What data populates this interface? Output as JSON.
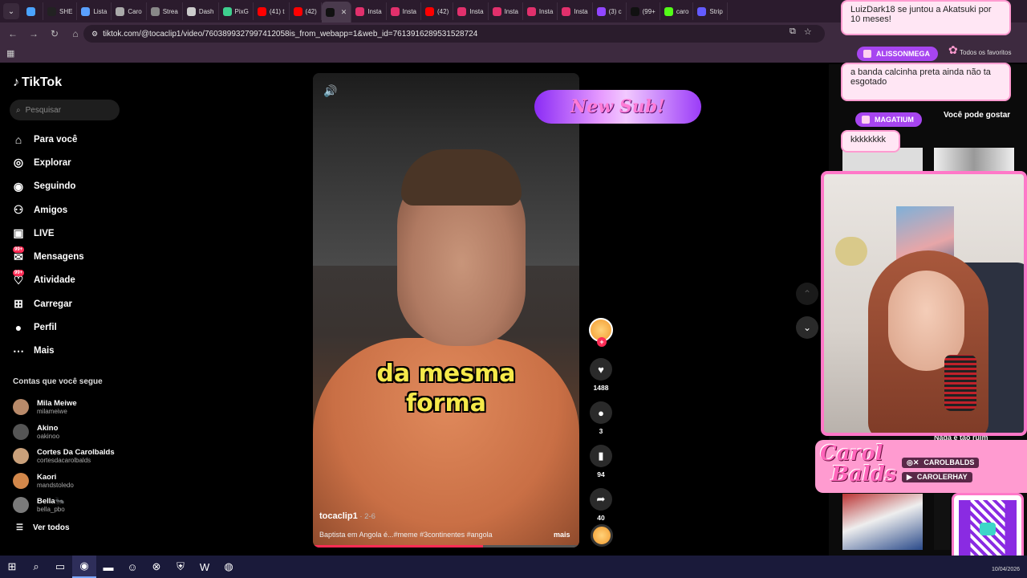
{
  "browser": {
    "tabs": [
      {
        "label": "",
        "color": "#4aa3ff"
      },
      {
        "label": "SHE",
        "color": "#222222"
      },
      {
        "label": "Lista",
        "color": "#5aa0ff"
      },
      {
        "label": "Caro",
        "color": "#aaaaaa"
      },
      {
        "label": "Strea",
        "color": "#888888"
      },
      {
        "label": "Dash",
        "color": "#cccccc"
      },
      {
        "label": "PixG",
        "color": "#3ecf8e"
      },
      {
        "label": "(41) t",
        "color": "#ff0000"
      },
      {
        "label": "(42)",
        "color": "#ff0000"
      },
      {
        "label": "",
        "color": "#111111",
        "active": true
      },
      {
        "label": "Insta",
        "color": "#e1306c"
      },
      {
        "label": "Insta",
        "color": "#e1306c"
      },
      {
        "label": "(42)",
        "color": "#ff0000"
      },
      {
        "label": "Insta",
        "color": "#e1306c"
      },
      {
        "label": "Insta",
        "color": "#e1306c"
      },
      {
        "label": "Insta",
        "color": "#e1306c"
      },
      {
        "label": "Insta",
        "color": "#e1306c"
      },
      {
        "label": "(3) c",
        "color": "#9146ff"
      },
      {
        "label": "(99+",
        "color": "#111111"
      },
      {
        "label": "caro",
        "color": "#53fc18"
      },
      {
        "label": "Strip",
        "color": "#635bff"
      }
    ],
    "url": "tiktok.com/@tocaclip1/video/7603899327997412058is_from_webapp=1&web_id=7613916289531528724",
    "bookmarks_folder": "Todos os favoritos"
  },
  "tiktok": {
    "logo": "TikTok",
    "search_placeholder": "Pesquisar",
    "menu": [
      {
        "label": "Para você",
        "icon": "home-icon"
      },
      {
        "label": "Explorar",
        "icon": "compass-icon"
      },
      {
        "label": "Seguindo",
        "icon": "following-icon"
      },
      {
        "label": "Amigos",
        "icon": "friends-icon"
      },
      {
        "label": "LIVE",
        "icon": "live-icon"
      },
      {
        "label": "Mensagens",
        "icon": "messages-icon",
        "badge": "99+"
      },
      {
        "label": "Atividade",
        "icon": "activity-icon",
        "badge": "99+"
      },
      {
        "label": "Carregar",
        "icon": "upload-icon"
      },
      {
        "label": "Perfil",
        "icon": "profile-icon"
      },
      {
        "label": "Mais",
        "icon": "more-icon"
      }
    ],
    "follows_title": "Contas que você segue",
    "follows": [
      {
        "name": "Mila Meiwe",
        "handle": "milameiwe",
        "color": "#b88a6a"
      },
      {
        "name": "Akino",
        "handle": "oakinoo",
        "color": "#555555"
      },
      {
        "name": "Cortes Da Carolbalds",
        "handle": "cortesdacarolbalds",
        "color": "#c9a07a"
      },
      {
        "name": "Kaori",
        "handle": "mandstoledo",
        "color": "#d2874a"
      },
      {
        "name": "Bella🐜",
        "handle": "bella_pbo",
        "color": "#7a7a7a"
      }
    ],
    "see_all": "Ver todos"
  },
  "video": {
    "caption_line1": "da mesma",
    "caption_line2": "forma",
    "author": "tocaclip1",
    "date": " · 2-6",
    "description": "Baptista em Angola é...#meme #3continentes #angola",
    "more": "mais",
    "progress": 0.64
  },
  "actions": {
    "likes": "1488",
    "comments": "3",
    "saves": "94",
    "shares": "40"
  },
  "overlay": {
    "new_sub": "New Sub!",
    "chat": [
      {
        "text": "LuizDark18 se juntou a Akatsuki por 10 meses!"
      },
      {
        "name": "ALISSONMEGA",
        "text": "a banda calcinha preta ainda não ta esgotado"
      },
      {
        "name": "MAGATIUM",
        "text": "kkkkkkkk"
      }
    ],
    "suggest_title": "Você pode gostar",
    "nada_text": "Nada é tão ruim",
    "brand_logo_line1": "Carol",
    "brand_logo_line2": "Balds",
    "brand_social1": "CAROLBALDS",
    "brand_social2": "CAROLERHAY"
  },
  "taskbar": {
    "date": "10/04/2026"
  }
}
